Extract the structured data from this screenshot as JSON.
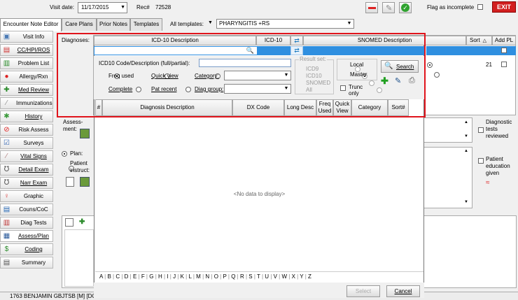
{
  "header": {
    "visit_date_label": "Visit date:",
    "visit_date": "11/17/2015",
    "rec_label": "Rec#",
    "rec_value": "72528",
    "flag_label": "Flag as incomplete",
    "exit_label": "EXIT"
  },
  "tabs": [
    "Encounter Note Editor",
    "Care Plans",
    "Prior Notes",
    "Templates"
  ],
  "templates": {
    "label": "All templates:",
    "value": "PHARYNGITIS +RS"
  },
  "sidebar": [
    {
      "label": "Visit Info"
    },
    {
      "label": "CC/HPI/ROS"
    },
    {
      "label": "Problem List"
    },
    {
      "label": "Allergy/Rxn"
    },
    {
      "label": "Med Review"
    },
    {
      "label": "Immunizations"
    },
    {
      "label": "History"
    },
    {
      "label": "Risk Assess"
    },
    {
      "label": "Surveys"
    },
    {
      "label": "Vital Signs"
    },
    {
      "label": "Detail Exam"
    },
    {
      "label": "Narr Exam"
    },
    {
      "label": "Graphic"
    },
    {
      "label": "Couns/CoC"
    },
    {
      "label": "Diag Tests"
    },
    {
      "label": "Assess/Plan"
    },
    {
      "label": "Coding"
    },
    {
      "label": "Summary"
    }
  ],
  "diagnoses": {
    "label": "Diagnoses:",
    "col_icd_desc": "ICD-10 Description",
    "col_icd": "ICD-10",
    "col_snomed": "SNOMED Description",
    "col_sort": "Sort",
    "col_addpl": "Add PL",
    "row_sort_value": "21"
  },
  "search": {
    "code_label": "ICD10 Code/Description (full/partial):",
    "code_value": "",
    "freq_used": "Freq used",
    "quick_view": "Quick view",
    "category": "Category:",
    "complete": "Complete",
    "pat_recent": "Pat recent",
    "diag_group": "Diag group:",
    "result_set_label": "Result set:",
    "result_icd9": "ICD9",
    "result_icd10": "ICD10",
    "result_snomed": "SNOMED",
    "result_all": "All",
    "local": "Local",
    "master": "Master",
    "trunc_only": "Trunc only",
    "search_btn": "Search"
  },
  "results": {
    "col_hash": "#",
    "col_diag_desc": "Diagnosis Description",
    "col_dx_code": "DX Code",
    "col_long_desc": "Long Desc",
    "col_freq_used": "Freq Used",
    "col_quick_view": "Quick View",
    "col_category": "Category",
    "col_sort": "Sort#",
    "empty_msg": "<No data to display>"
  },
  "alphabet": [
    "A",
    "B",
    "C",
    "D",
    "E",
    "F",
    "G",
    "H",
    "I",
    "J",
    "K",
    "L",
    "M",
    "N",
    "O",
    "P",
    "Q",
    "R",
    "S",
    "T",
    "U",
    "V",
    "W",
    "X",
    "Y",
    "Z"
  ],
  "buttons": {
    "select": "Select",
    "cancel": "Cancel"
  },
  "background": {
    "assessment_label": "Assess-ment:",
    "plan_label": "Plan:",
    "patient_instruct_label": "Patient instruct:",
    "diagnostic_tests_reviewed": "Diagnostic tests reviewed",
    "patient_education_given": "Patient education given"
  },
  "status_bar": {
    "patient": "1763 BENJAMIN GBJTSB [M] [DOB"
  },
  "colors": {
    "highlight_border": "#e0141c",
    "selection_blue": "#2f8fe0",
    "exit_red": "#d21f1f"
  }
}
